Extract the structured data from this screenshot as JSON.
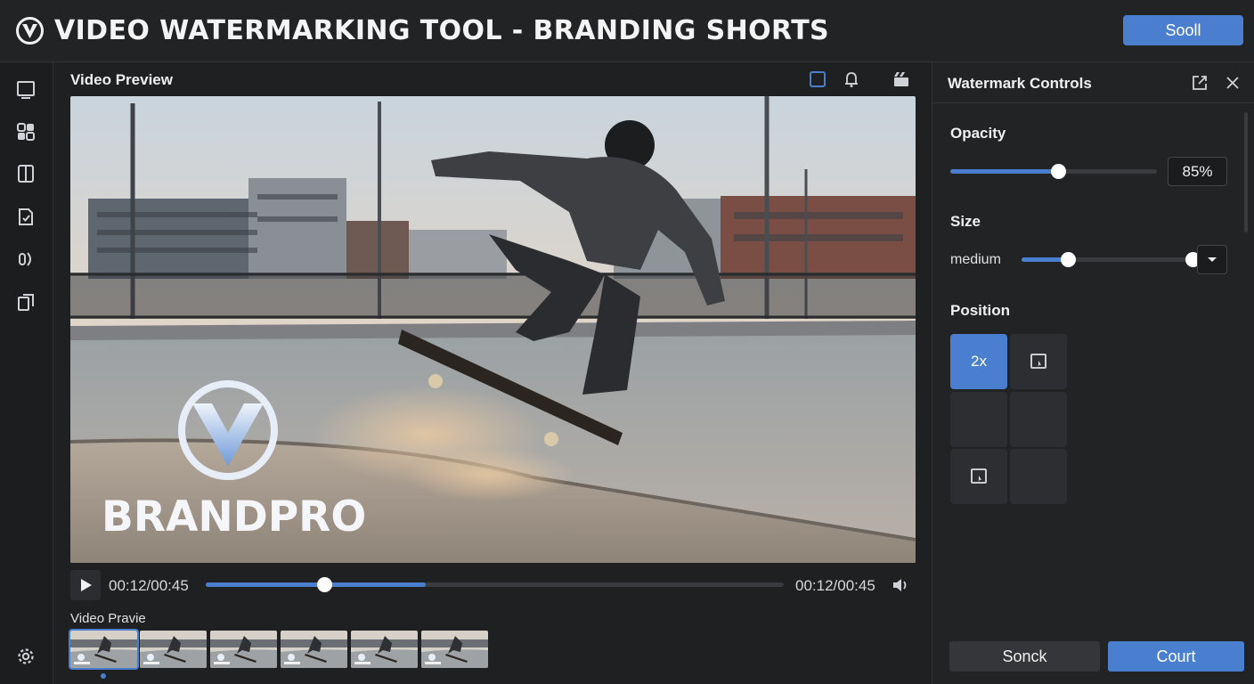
{
  "header": {
    "title": "VIDEO WATERMARKING TOOL - BRANDING SHORTS",
    "logo_icon": "v-shield-logo-icon",
    "action_label": "Sooll"
  },
  "sidebar": {
    "items": [
      {
        "icon": "frame-icon"
      },
      {
        "icon": "grid-icon"
      },
      {
        "icon": "split-icon"
      },
      {
        "icon": "check-doc-icon"
      },
      {
        "icon": "audio-icon"
      },
      {
        "icon": "layers-icon"
      }
    ],
    "settings_icon": "gear-icon"
  },
  "preview": {
    "label": "Video Preview",
    "toolbar_icons": [
      "crop-icon",
      "bell-icon",
      "clapper-icon"
    ],
    "watermark_text": "BRANDPRO",
    "current_time": "00:12/00:45",
    "end_time": "00:12/00:45",
    "progress": 0.385,
    "buffered": 0.38,
    "strip_label": "Video Pravie",
    "thumbnail_count": 6,
    "selected_thumbnail": 0
  },
  "panel": {
    "title": "Watermark Controls",
    "opacity": {
      "label": "Opacity",
      "value": "85%",
      "level": 0.52
    },
    "size": {
      "label": "Size",
      "value": "medium",
      "level": 0.27
    },
    "position": {
      "label": "Position",
      "active_label": "2x"
    },
    "buttons": {
      "secondary": "Sonck",
      "primary": "Court"
    }
  },
  "colors": {
    "accent": "#4a7fd0",
    "background": "#1e1f21",
    "panel": "#222325"
  }
}
